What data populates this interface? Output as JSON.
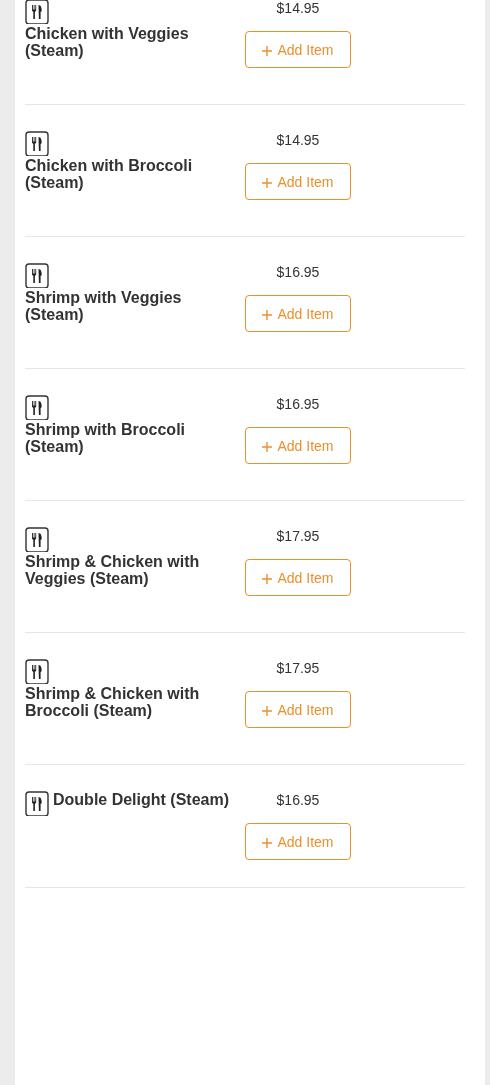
{
  "menu_items": [
    {
      "name": "Chicken with Veggies (Steam)",
      "price": "$14.95",
      "button": "Add Item"
    },
    {
      "name": "Chicken with Broccoli (Steam)",
      "price": "$14.95",
      "button": "Add Item"
    },
    {
      "name": "Shrimp with Veggies (Steam)",
      "price": "$16.95",
      "button": "Add Item"
    },
    {
      "name": "Shrimp with Broccoli (Steam)",
      "price": "$16.95",
      "button": "Add Item"
    },
    {
      "name": "Shrimp & Chicken with Veggies (Steam)",
      "price": "$17.95",
      "button": "Add Item"
    },
    {
      "name": "Shrimp & Chicken with Broccoli (Steam)",
      "price": "$17.95",
      "button": "Add Item"
    },
    {
      "name": "Double Delight (Steam)",
      "price": "$16.95",
      "button": "Add Item"
    }
  ]
}
